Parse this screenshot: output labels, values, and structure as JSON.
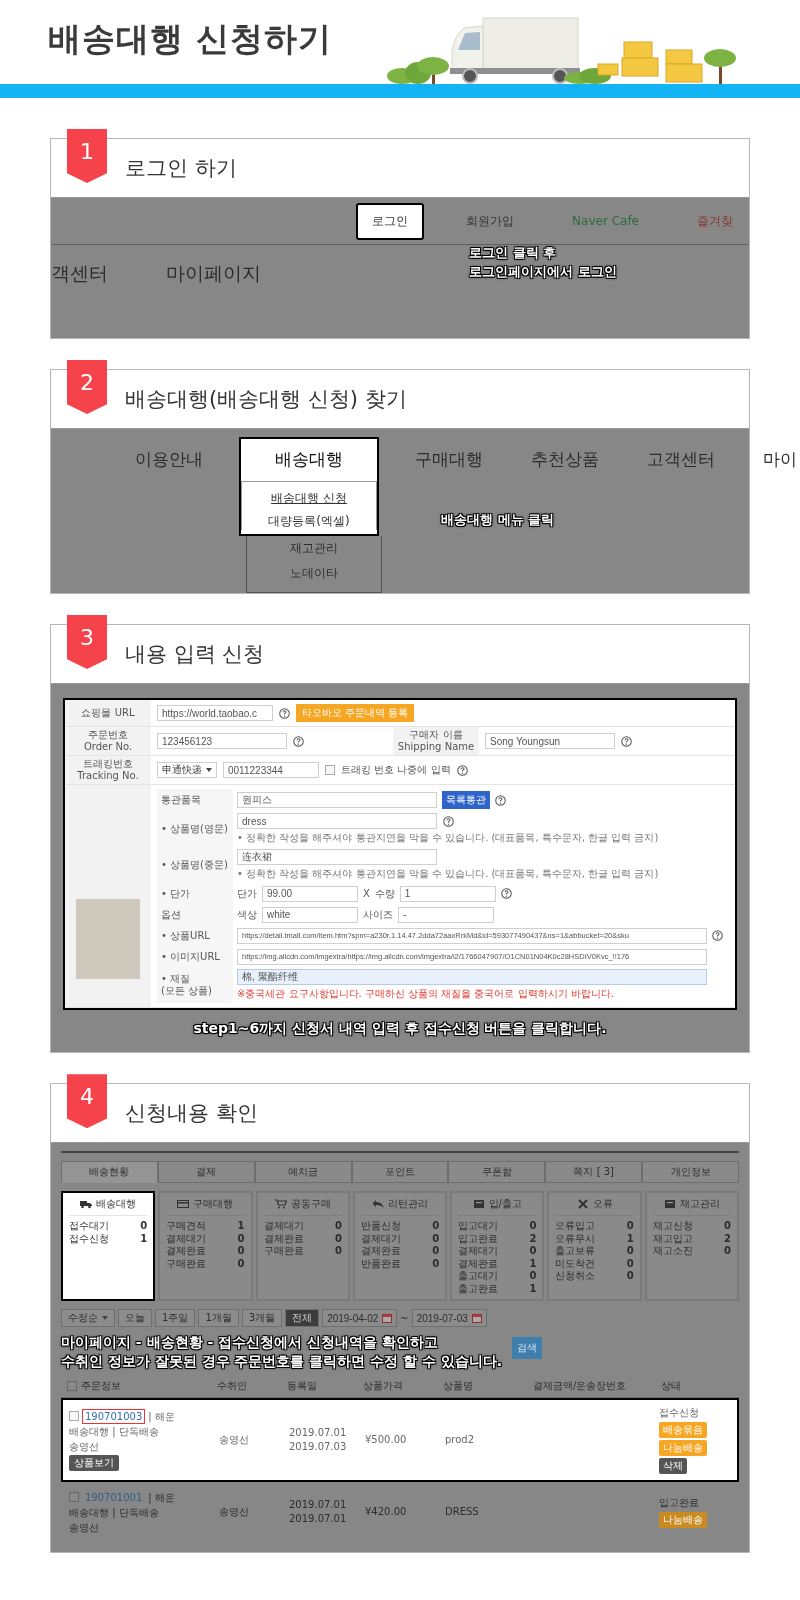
{
  "page_title": "배송대행 신청하기",
  "steps": [
    {
      "kind": "login",
      "number": "1",
      "title": "로그인 하기",
      "top_links": [
        {
          "label": "로그인",
          "highlighted": true
        },
        {
          "label": "회원가입",
          "highlighted": false
        },
        {
          "label": "Naver Cafe",
          "highlighted": false
        },
        {
          "label": "즐겨찾",
          "highlighted": false
        }
      ],
      "nav_items": [
        "객센터",
        "마이페이지"
      ],
      "callout": [
        "로그인 클릭 후",
        "로그인페이지에서 로그인"
      ]
    },
    {
      "kind": "menu",
      "number": "2",
      "title": "배송대행(배송대행 신청) 찾기",
      "nav_items": [
        {
          "label": "이용안내",
          "selected": false
        },
        {
          "label": "배송대행",
          "selected": true
        },
        {
          "label": "구매대행",
          "selected": false
        },
        {
          "label": "추천상품",
          "selected": false
        },
        {
          "label": "고객센터",
          "selected": false
        },
        {
          "label": "마이",
          "selected": false
        }
      ],
      "submenu": [
        {
          "label": "배송대행 신청",
          "selected": true,
          "highlighted": true
        },
        {
          "label": "대량등록(엑셀)",
          "selected": false,
          "highlighted": true
        },
        {
          "label": "재고관리",
          "selected": false,
          "highlighted": false
        },
        {
          "label": "노데이타",
          "selected": false,
          "highlighted": false
        }
      ],
      "callout": [
        "배송대행 메뉴 클릭"
      ]
    },
    {
      "kind": "form",
      "number": "3",
      "title": "내용 입력 신청",
      "form": {
        "shop_url": {
          "label": "쇼핑몰 URL",
          "value": "https://world.taobao.c",
          "button": "타오바오 주문내역 등록"
        },
        "order_no": {
          "label": "주문번호",
          "label_en": "Order No.",
          "value": "123456123"
        },
        "buyer": {
          "label": "구매자 이름",
          "label_en": "Shipping Name",
          "value": "Song Youngsun"
        },
        "tracking": {
          "label": "트래킹번호",
          "label_en": "Tracking No.",
          "carrier": "申通快递",
          "value": "0011223344",
          "later_label": "트래킹 번호 나중에 입력",
          "later_checked": false
        },
        "product": {
          "customs": {
            "label": "통관품목",
            "value": "원피스",
            "button": "목록통관"
          },
          "name_en": {
            "label": "• 상품명(영문)",
            "value": "dress",
            "note": "• 정확한 작성을 해주셔야 통관지연을 막을 수 있습니다. (대표품목, 특수문자, 한글 입력 금지)"
          },
          "name_cn": {
            "label": "• 상품명(중문)",
            "value": "连衣裙",
            "note": "• 정확한 작성을 해주셔야 통관지연을 막을 수 있습니다. (대표품목, 특수문자, 한글 입력 금지)"
          },
          "price": {
            "label": "• 단가",
            "price_label": "단가",
            "price": "99.00",
            "times": "X",
            "qty_label": "수량",
            "qty": "1"
          },
          "option": {
            "label": "옵션",
            "shade_label": "색상",
            "shade": "white",
            "size_label": "사이즈",
            "size": "-"
          },
          "url": {
            "label": "• 상품URL",
            "value": "https://detail.tmall.com/item.htm?spm=a230r.1.14.47.2dda72aaxRrkMd&id=593077490437&ns=1&abbucket=20&sku"
          },
          "image_url": {
            "label": "• 이미지URL",
            "value": "https://img.alicdn.com/imgextra/https://img.alicdn.com/imgextra/i2/1766047907/O1CN01N04K0c28HSDIV0Kvc_!!176"
          },
          "material": {
            "label": "• 재질",
            "label_sub": "(모든 상품)",
            "value": "棉, 聚酯纤维",
            "note": "※중국세관 요구사항입니다. 구매하신 상품의 재질을 중국어로 입력하시기 바랍니다."
          }
        }
      },
      "callout": [
        "step1~6까지 신청서 내역 입력 후 접수신청 버튼을 클릭합니다."
      ]
    },
    {
      "kind": "mypage",
      "number": "4",
      "title": "신청내용 확인",
      "tabs": [
        {
          "label": "배송현황",
          "selected": true
        },
        {
          "label": "결제",
          "selected": false
        },
        {
          "label": "예치금",
          "selected": false
        },
        {
          "label": "포인트",
          "selected": false
        },
        {
          "label": "쿠폰함",
          "selected": false
        },
        {
          "label": "쪽지 [ 3]",
          "selected": false
        },
        {
          "label": "개인정보",
          "selected": false
        }
      ],
      "summary": [
        {
          "title": "배송대행",
          "highlighted": true,
          "rows": [
            {
              "label": "접수대기",
              "count": "0"
            },
            {
              "label": "접수신청",
              "count": "1"
            }
          ]
        },
        {
          "title": "구매대행",
          "highlighted": false,
          "rows": [
            {
              "label": "구매견적",
              "count": "1"
            },
            {
              "label": "결제대기",
              "count": "0"
            },
            {
              "label": "결제완료",
              "count": "0"
            },
            {
              "label": "구매완료",
              "count": "0"
            }
          ]
        },
        {
          "title": "공동구매",
          "highlighted": false,
          "rows": [
            {
              "label": "결제대기",
              "count": "0"
            },
            {
              "label": "결제완료",
              "count": "0"
            },
            {
              "label": "구매완료",
              "count": "0"
            }
          ]
        },
        {
          "title": "리턴관리",
          "highlighted": false,
          "rows": [
            {
              "label": "반품신청",
              "count": "0"
            },
            {
              "label": "결제대기",
              "count": "0"
            },
            {
              "label": "결제완료",
              "count": "0"
            },
            {
              "label": "반품완료",
              "count": "0"
            }
          ]
        },
        {
          "title": "입/출고",
          "highlighted": false,
          "rows": [
            {
              "label": "입고대기",
              "count": "0"
            },
            {
              "label": "입고완료",
              "count": "2"
            },
            {
              "label": "결제대기",
              "count": "0"
            },
            {
              "label": "결제완료",
              "count": "1"
            },
            {
              "label": "출고대기",
              "count": "0"
            },
            {
              "label": "출고완료",
              "count": "1"
            }
          ]
        },
        {
          "title": "오류",
          "highlighted": false,
          "rows": [
            {
              "label": "오류입고",
              "count": "0"
            },
            {
              "label": "오류무시",
              "count": "1"
            },
            {
              "label": "출고보류",
              "count": "0"
            },
            {
              "label": "미도착건",
              "count": "0"
            },
            {
              "label": "신청취소",
              "count": "0"
            }
          ]
        },
        {
          "title": "재고관리",
          "highlighted": false,
          "rows": [
            {
              "label": "재고신청",
              "count": "0"
            },
            {
              "label": "재고입고",
              "count": "2"
            },
            {
              "label": "재고소진",
              "count": "0"
            }
          ]
        }
      ],
      "filter": {
        "sort": "수정순",
        "periods": [
          {
            "label": "오늘",
            "selected": false
          },
          {
            "label": "1주일",
            "selected": false
          },
          {
            "label": "1개월",
            "selected": false
          },
          {
            "label": "3개월",
            "selected": false
          },
          {
            "label": "전체",
            "selected": true
          }
        ],
        "date_from": "2019-04-02",
        "tilde": "~",
        "date_to": "2019-07-03",
        "search": "검색"
      },
      "callout": [
        "마이페이지 - 배송현황 - 접수신청에서 신청내역을 확인하고",
        "수취인 정보가 잘못된 경우 주문번호를 클릭하면 수정 할 수 있습니다."
      ],
      "table": {
        "all_checked": false,
        "columns": [
          "주문정보",
          "수취인",
          "등록일",
          "상품가격",
          "상품명",
          "결제금액/운송장번호",
          "상태"
        ],
        "rows": [
          {
            "highlighted": true,
            "checked": false,
            "order_no": "190701003",
            "transport": "| 해운",
            "service": "배송대행 | 단독배송",
            "sender": "송영선",
            "view_button": "상품보기",
            "recipient": "송영선",
            "dates": [
              "2019.07.01",
              "2019.07.03"
            ],
            "price": "¥500.00",
            "product": "prod2",
            "status": "접수신청",
            "actions": [
              {
                "label": "배송묶음",
                "color": "#f5a623"
              },
              {
                "label": "나눔배송",
                "color": "#f5a623"
              },
              {
                "label": "삭제",
                "color": "#555555"
              }
            ]
          },
          {
            "highlighted": false,
            "checked": false,
            "order_no": "190701001",
            "transport": "| 해운",
            "service": "배송대행 | 단독배송",
            "sender": "송영선",
            "recipient": "송영선",
            "dates": [
              "2019.07.01",
              "2019.07.01"
            ],
            "price": "¥420.00",
            "product": "DRESS",
            "status": "입고완료",
            "actions": [
              {
                "label": "나눔배송",
                "color": "#c98a20"
              }
            ]
          }
        ]
      }
    }
  ]
}
